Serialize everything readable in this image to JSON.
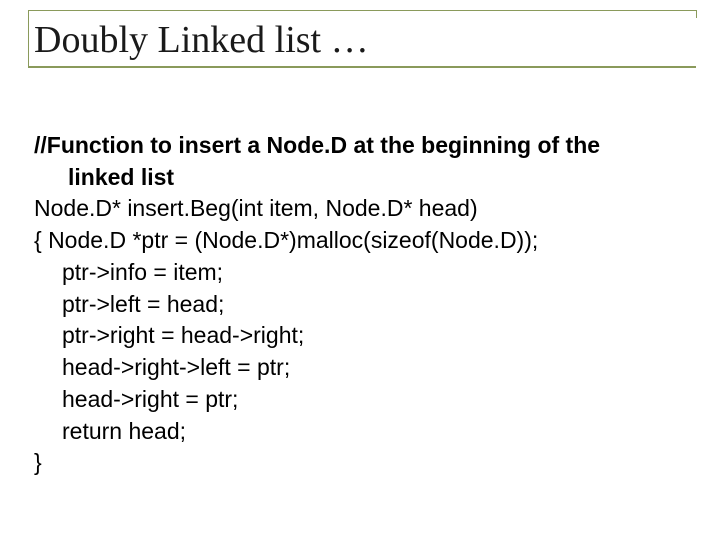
{
  "title": "Doubly Linked list …",
  "code": {
    "comment1": "//Function to insert a Node.D at the beginning of the",
    "comment2": "linked list",
    "line1": "Node.D* insert.Beg(int item, Node.D* head)",
    "line2": " { Node.D *ptr = (Node.D*)malloc(sizeof(Node.D));",
    "line3": "ptr->info = item;",
    "line4": "ptr->left = head;",
    "line5": "ptr->right = head->right;",
    "line6": "head->right->left = ptr;",
    "line7": "head->right = ptr;",
    "line8": "return head;",
    "line9": "}"
  }
}
